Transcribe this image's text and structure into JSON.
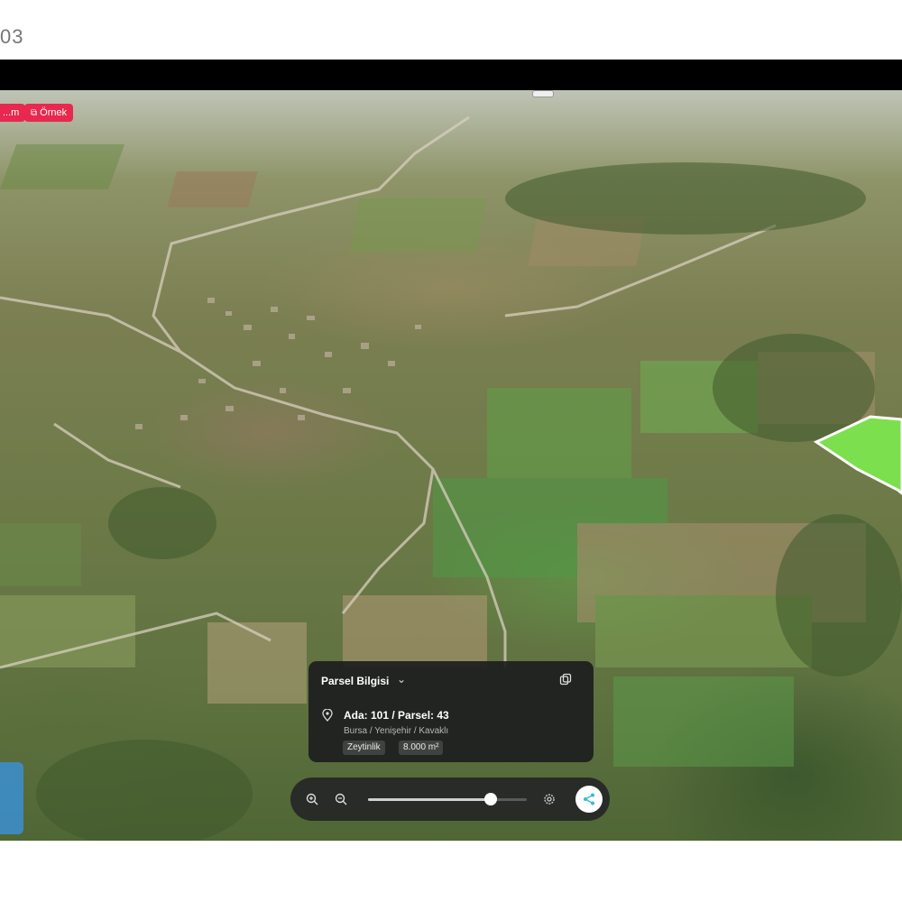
{
  "corner_label": "03",
  "badges": {
    "left": "...m",
    "right": "Örnek"
  },
  "parcel_info": {
    "title": "Parsel Bilgisi",
    "parcel_number": "Ada: 101 / Parsel: 43",
    "location": "Bursa / Yenişehir / Kavaklı",
    "land_type": "Zeytinlik",
    "area": "8.000 m²"
  },
  "toolbar": {
    "zoom_level": 0.77
  },
  "colors": {
    "badge": "#e8284f",
    "parcel_fill": "#7cdf4d",
    "panel_bg": "#1c1c1e",
    "share_accent": "#36b9d8"
  },
  "icons": {
    "badge": "image-icon",
    "card_copy": "copy-icon",
    "pin": "location-pin-icon",
    "zoom_in": "zoom-in-icon",
    "zoom_out": "zoom-out-icon",
    "settings": "settings-icon",
    "share": "share-icon"
  }
}
